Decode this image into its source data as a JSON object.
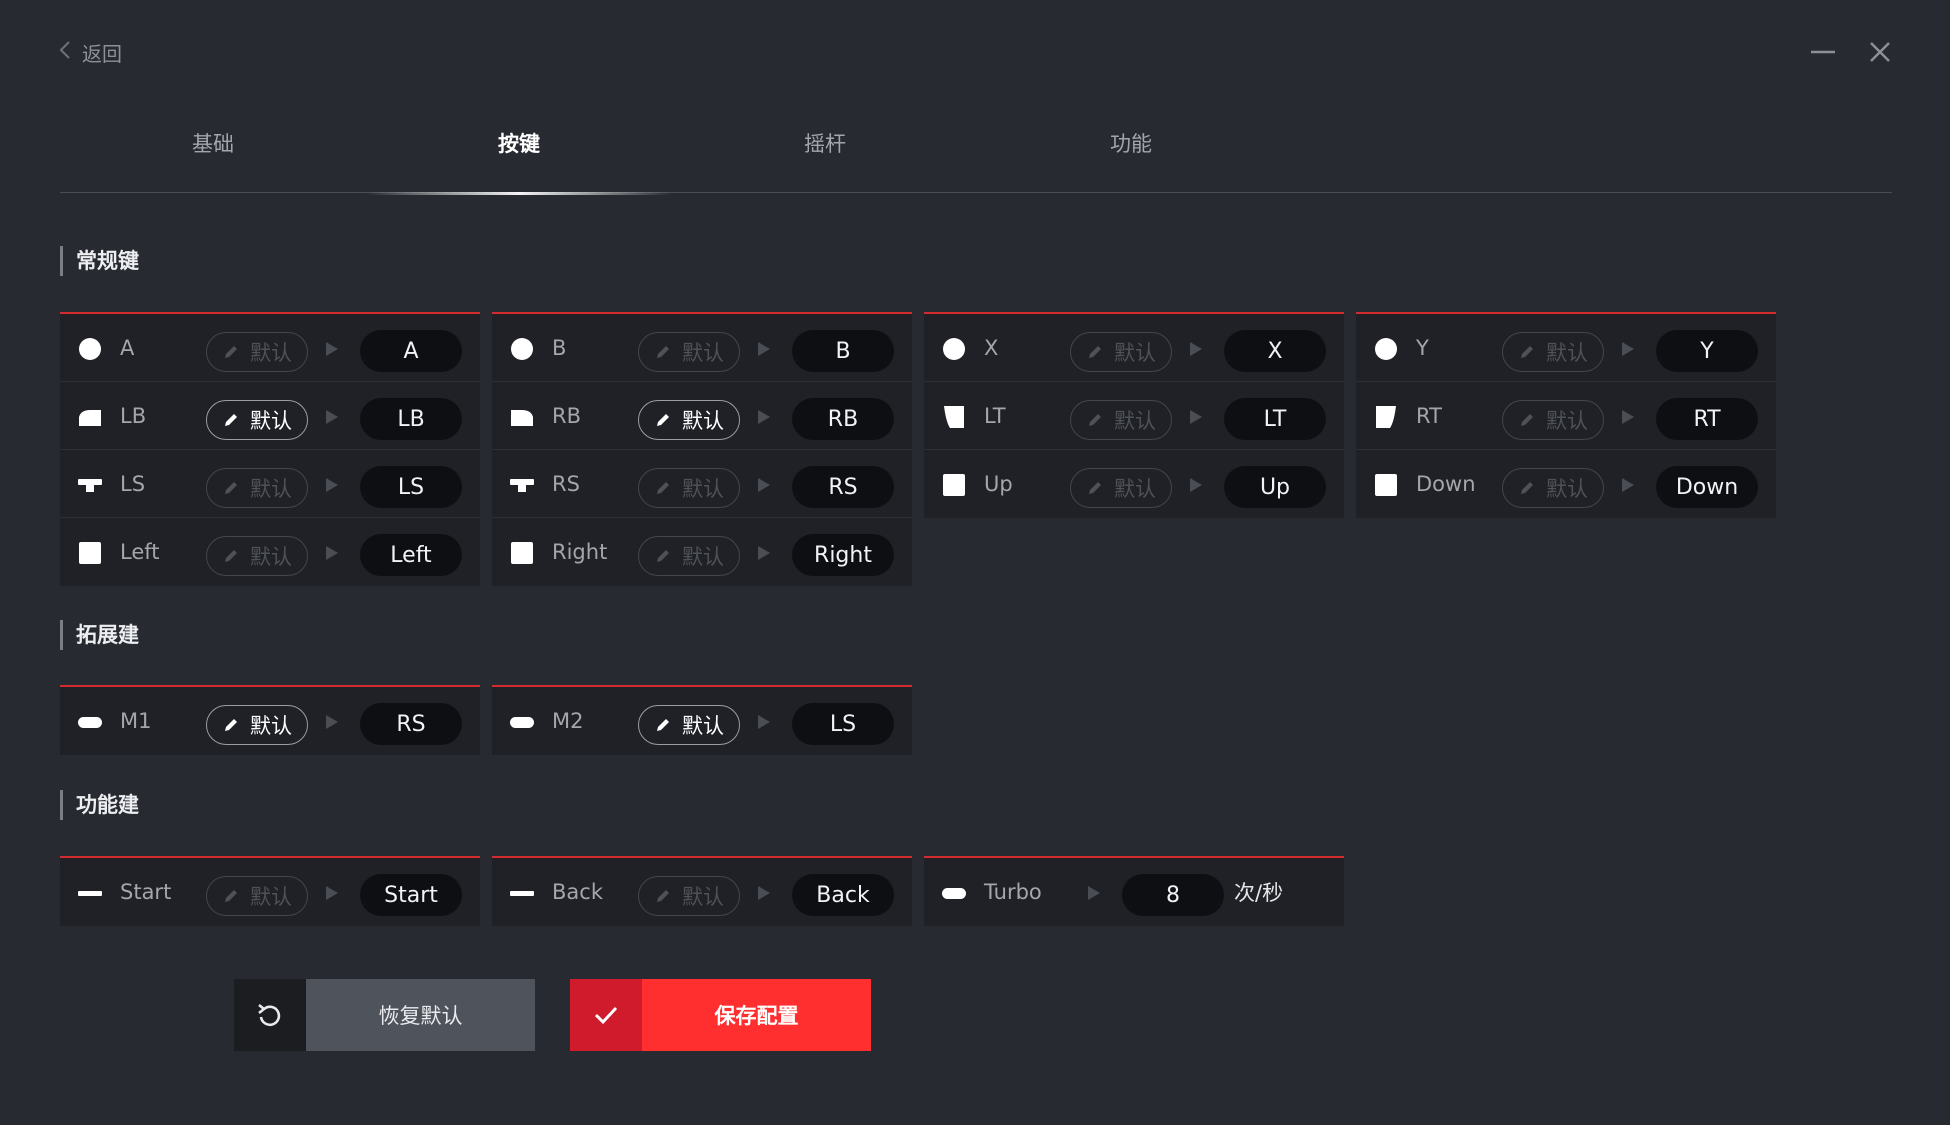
{
  "window": {
    "back_label": "返回"
  },
  "tabs": [
    {
      "label": "基础"
    },
    {
      "label": "按键",
      "active": true
    },
    {
      "label": "摇杆"
    },
    {
      "label": "功能"
    }
  ],
  "sections": {
    "regular": "常规键",
    "extended": "拓展建",
    "function": "功能建"
  },
  "edit_label": "默认",
  "regular_buttons": [
    {
      "name": "A",
      "icon": "circle-button-icon",
      "mapping": "A",
      "edit_active": false
    },
    {
      "name": "LB",
      "icon": "bumper-left-icon",
      "mapping": "LB",
      "edit_active": true
    },
    {
      "name": "LS",
      "icon": "stick-press-icon",
      "mapping": "LS",
      "edit_active": false
    },
    {
      "name": "Left",
      "icon": "dpad-square-icon",
      "mapping": "Left",
      "edit_active": false
    },
    {
      "name": "B",
      "icon": "circle-button-icon",
      "mapping": "B",
      "edit_active": false
    },
    {
      "name": "RB",
      "icon": "bumper-right-icon",
      "mapping": "RB",
      "edit_active": true
    },
    {
      "name": "RS",
      "icon": "stick-press-icon",
      "mapping": "RS",
      "edit_active": false
    },
    {
      "name": "Right",
      "icon": "dpad-square-icon",
      "mapping": "Right",
      "edit_active": false
    },
    {
      "name": "X",
      "icon": "circle-button-icon",
      "mapping": "X",
      "edit_active": false
    },
    {
      "name": "LT",
      "icon": "trigger-left-icon",
      "mapping": "LT",
      "edit_active": false
    },
    {
      "name": "Up",
      "icon": "dpad-square-icon",
      "mapping": "Up",
      "edit_active": false
    },
    {
      "name": "Y",
      "icon": "circle-button-icon",
      "mapping": "Y",
      "edit_active": false
    },
    {
      "name": "RT",
      "icon": "trigger-right-icon",
      "mapping": "RT",
      "edit_active": false
    },
    {
      "name": "Down",
      "icon": "dpad-square-icon",
      "mapping": "Down",
      "edit_active": false
    }
  ],
  "extended_buttons": [
    {
      "name": "M1",
      "icon": "pill-button-icon",
      "mapping": "RS",
      "edit_active": true
    },
    {
      "name": "M2",
      "icon": "pill-button-icon",
      "mapping": "LS",
      "edit_active": true
    }
  ],
  "function_buttons": [
    {
      "name": "Start",
      "icon": "bar-button-icon",
      "mapping": "Start",
      "edit_active": false
    },
    {
      "name": "Back",
      "icon": "bar-button-icon",
      "mapping": "Back",
      "edit_active": false
    }
  ],
  "turbo": {
    "name": "Turbo",
    "icon": "pill-button-icon",
    "value": "8",
    "unit": "次/秒"
  },
  "actions": {
    "reset_label": "恢复默认",
    "save_label": "保存配置"
  },
  "colors": {
    "background": "#272a30",
    "card": "#1f2126",
    "accent_red": "#ff2f2f",
    "card_top_border": "#d42a2d"
  }
}
